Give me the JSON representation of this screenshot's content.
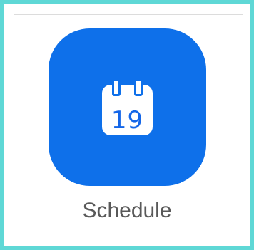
{
  "app": {
    "label": "Schedule",
    "icon": "calendar-icon",
    "icon_day": "19",
    "accent_color": "#0e70ea",
    "frame_color": "#5fd8d6"
  }
}
